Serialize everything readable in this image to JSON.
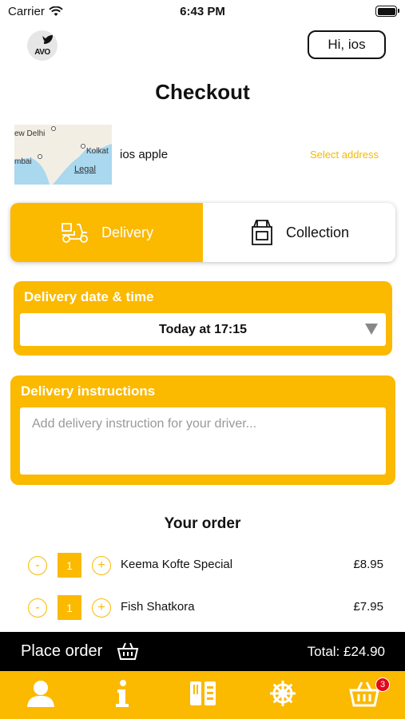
{
  "status_bar": {
    "carrier": "Carrier",
    "time": "6:43 PM"
  },
  "header": {
    "logo_text": "AVO",
    "greeting": "Hi, ios",
    "title": "Checkout"
  },
  "address": {
    "map_labels": [
      "ew Delhi",
      "Kolkat",
      "mbai"
    ],
    "map_legal": "Legal",
    "name": "ios apple",
    "select_label": "Select address"
  },
  "fulfilment": {
    "selected": "Delivery",
    "options": [
      {
        "label": "Delivery",
        "icon": "scooter-icon"
      },
      {
        "label": "Collection",
        "icon": "bag-icon"
      }
    ]
  },
  "delivery_time": {
    "title": "Delivery date & time",
    "selected": "Today at 17:15"
  },
  "instructions": {
    "title": "Delivery instructions",
    "placeholder": "Add delivery instruction for your driver...",
    "value": ""
  },
  "order": {
    "heading": "Your order",
    "items": [
      {
        "minus": "-",
        "qty": "1",
        "plus": "+",
        "name": "Keema Kofte Special",
        "price": "£8.95"
      },
      {
        "minus": "-",
        "qty": "1",
        "plus": "+",
        "name": "Fish Shatkora",
        "price": "£7.95"
      }
    ]
  },
  "checkout_bar": {
    "label": "Place order",
    "total": "Total: £24.90"
  },
  "tab_bar": {
    "tabs": [
      "profile-icon",
      "info-icon",
      "menu-icon",
      "settings-icon",
      "basket-icon"
    ],
    "basket_count": "3"
  },
  "colors": {
    "accent": "#fbb900",
    "bar": "#000000",
    "badge": "#e3061b"
  }
}
